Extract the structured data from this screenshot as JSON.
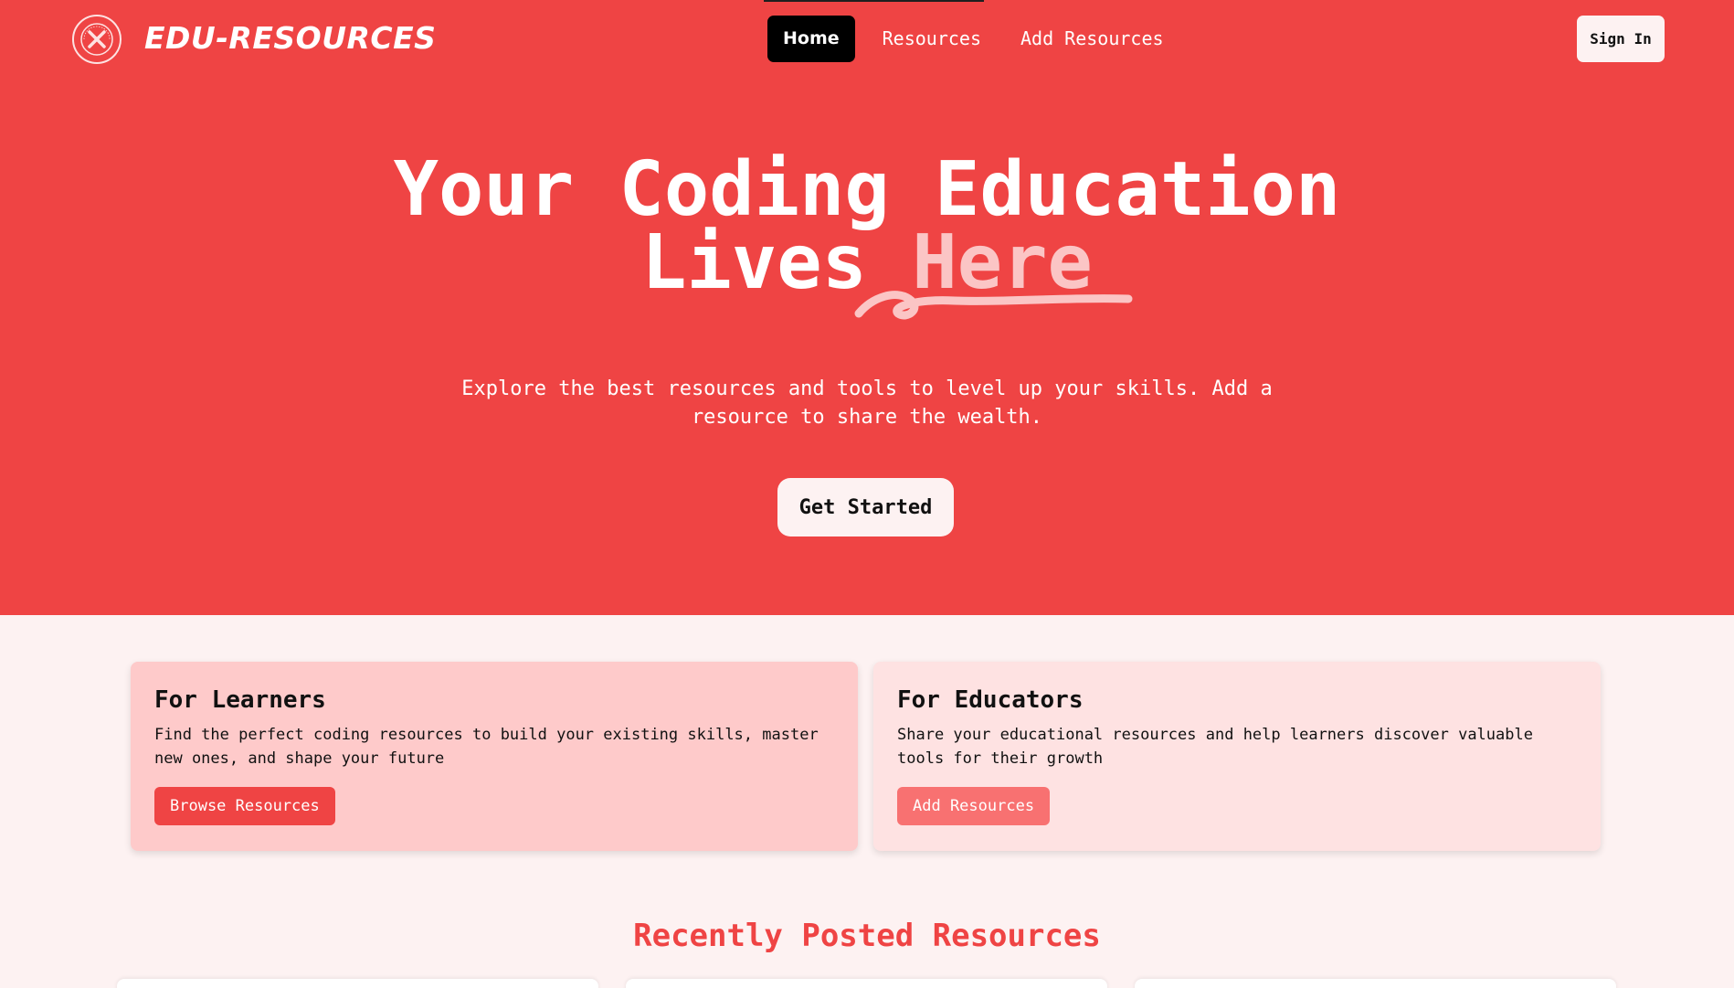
{
  "brand": {
    "name": "EDU-RESOURCES",
    "logo_text": "EDU RESOURCES · ESTD 2024"
  },
  "nav": {
    "items": [
      {
        "label": "Home",
        "active": true
      },
      {
        "label": "Resources",
        "active": false
      },
      {
        "label": "Add Resources",
        "active": false
      }
    ],
    "sign_in": "Sign In"
  },
  "hero": {
    "headline_line1": "Your Coding Education",
    "headline_line2_a": "Lives ",
    "headline_line2_b": "Here",
    "subtitle": "Explore the best resources and tools to level up your skills. Add a resource to share the wealth.",
    "cta": "Get Started"
  },
  "cards": {
    "learners": {
      "title": "For Learners",
      "text": "Find the perfect coding resources to build your existing skills, master new ones, and shape your future",
      "button": "Browse Resources"
    },
    "educators": {
      "title": "For Educators",
      "text": "Share your educational resources and help learners discover valuable tools for their growth",
      "button": "Add Resources"
    }
  },
  "recent": {
    "title": "Recently Posted Resources"
  },
  "colors": {
    "primary": "#ef4444",
    "background": "#fdf2f2",
    "learners_card": "#fecaca",
    "educators_card": "#fee2e2",
    "highlight": "#fbc5c5"
  }
}
